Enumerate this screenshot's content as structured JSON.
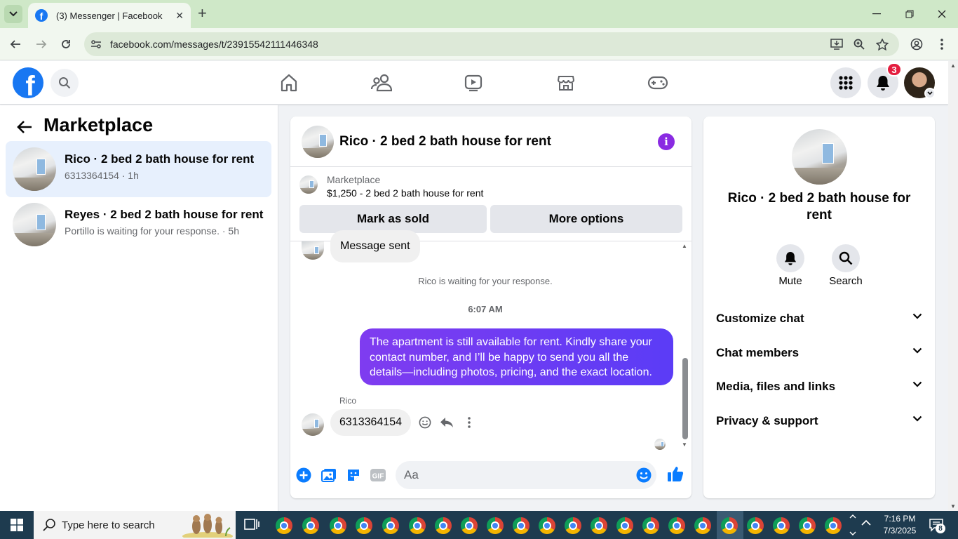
{
  "browser": {
    "tab_title": "(3) Messenger | Facebook",
    "tab_close": "✕",
    "new_tab": "+",
    "url": "facebook.com/messages/t/23915542111446348"
  },
  "fb_header": {
    "logo_letter": "f",
    "notification_count": "3"
  },
  "left_panel": {
    "title": "Marketplace",
    "conversations": [
      {
        "name": "Rico · 2 bed 2 bath house for rent",
        "subtitle": "6313364154 · 1h",
        "active": true
      },
      {
        "name": "Reyes · 2 bed 2 bath house for rent",
        "subtitle": "Portillo is waiting for your response. · 5h",
        "active": false
      }
    ]
  },
  "chat": {
    "title": "Rico · 2 bed 2 bath house for rent",
    "info_icon": "i",
    "marketplace": {
      "label": "Marketplace",
      "listing": "$1,250 - 2 bed 2 bath house for rent",
      "mark_sold": "Mark as sold",
      "more_options": "More options"
    },
    "messages": {
      "previous_partial": "Message sent",
      "waiting_notice": "Rico is waiting for your response.",
      "timestamp": "6:07 AM",
      "outgoing": "The apartment is still available for rent. Kindly share your contact number, and I’ll be happy to send you all the details—including photos, pricing, and the exact location.",
      "sender_name": "Rico",
      "incoming": "6313364154"
    },
    "composer": {
      "placeholder": "Aa"
    }
  },
  "info_panel": {
    "name": "Rico · 2 bed 2 bath house for rent",
    "actions": [
      {
        "label": "Mute",
        "icon": "bell-icon"
      },
      {
        "label": "Search",
        "icon": "search-icon"
      }
    ],
    "sections": [
      "Customize chat",
      "Chat members",
      "Media, files and links",
      "Privacy & support"
    ]
  },
  "taskbar": {
    "search_placeholder": "Type here to search",
    "time": "7:16 PM",
    "date": "7/3/2025",
    "notification_count": "8"
  },
  "colors": {
    "fb_blue": "#1877f2",
    "messenger_purple": "#7f3cf0",
    "active_conversation": "#e7f0fd",
    "taskbar": "#1e3b4f"
  }
}
